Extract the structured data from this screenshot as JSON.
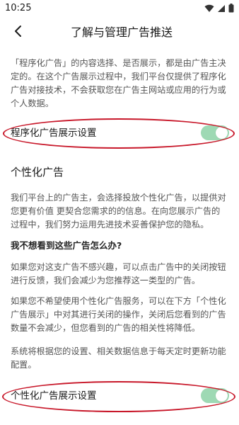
{
  "status_bar": {
    "time": "10:25"
  },
  "header": {
    "title": "了解与管理广告推送"
  },
  "intro": {
    "text": "「程序化广告」的内容选择、是否展示，都是由广告主决定的。在这个广告展示过程中，我们平台仅提供了程序化广告对接技术，不会获取您在广告主网站或应用的行为或个人数据。"
  },
  "programmatic_setting": {
    "label": "程序化广告展示设置",
    "enabled": true
  },
  "personalized_section": {
    "title": "个性化广告",
    "para1": "我们平台上的广告主，会选择投放个性化广告，以提供对您更有价值 更契合您需求的的信息。在向您展示广告的过程中，我们努力运用先进技术妥善保护您的隐私。",
    "question": "我不想看到这些广告怎么办?",
    "para2": "如果您对这支广告不感兴趣，可以点击广告中的关闭按钮进行反馈，我们会减少为您推荐这一类型的广告。",
    "para3": "如果您不希望使用个性化广告服务，可以在下方「个性化广告展示」中对其进行关闭的操作，关闭后您看到的广告数量不会减少，但您看到的广告的相关性将降低。",
    "para4": "系统将根据您的设置、相关数据信息于每天定时更新功能配置。"
  },
  "personalized_setting": {
    "label": "个性化广告展示设置",
    "enabled": true
  },
  "colors": {
    "toggle_on": "#9ed9b4",
    "annotation": "#c8182a"
  },
  "icons": {
    "status": [
      "wifi-icon",
      "signal-icon",
      "battery-icon"
    ],
    "back": "back-arrow-icon"
  }
}
